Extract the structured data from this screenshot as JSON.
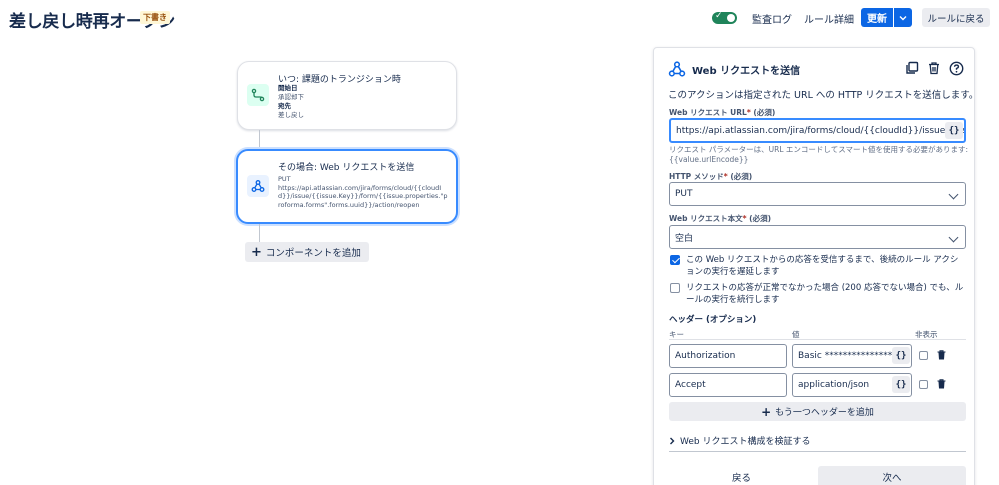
{
  "header": {
    "title": "差し戻し時再オープン",
    "draft_badge": "下書き",
    "audit_log": "監査ログ",
    "rule_details": "ルール詳細",
    "update": "更新",
    "back_to_rules": "ルールに戻る",
    "rule_enabled": true
  },
  "canvas": {
    "trigger": {
      "title": "いつ: 課題のトランジション時",
      "from_label": "開始日",
      "from_value": "承認却下",
      "to_label": "宛先",
      "to_value": "差し戻し"
    },
    "action": {
      "title": "その場合: Web リクエストを送信",
      "method": "PUT",
      "url": "https://api.atlassian.com/jira/forms/cloud/{{cloudId}}/issue/{{issue.Key}}/form/{{issue.properties.\"proforma.forms\".forms.uuid}}/action/reopen"
    },
    "add_component": "コンポーネントを追加"
  },
  "panel": {
    "title": "Web リクエストを送信",
    "description": "このアクションは指定された URL への HTTP リクエストを送信します。",
    "url_label": "Web リクエスト URL",
    "required": "(必須)",
    "url_value": "https://api.atlassian.com/jira/forms/cloud/{{cloudId}}/issue/{{issue.Key}}/f",
    "url_help": "リクエスト パラメーターは、URL エンコードしてスマート値を使用する必要があります: {{value.urlEncode}}",
    "method_label": "HTTP メソッド",
    "method_value": "PUT",
    "body_label": "Web リクエスト本文",
    "body_value": "空白",
    "wait_label": "この Web リクエストからの応答を受信するまで、後続のルール アクションの実行を遅延します",
    "wait_checked": true,
    "continue_label": "リクエストの応答が正常でなかった場合 (200 応答でない場合) でも、ルールの実行を続行します",
    "continue_checked": false,
    "headers_title": "ヘッダー (オプション)",
    "col_key": "キー",
    "col_value": "値",
    "col_hidden": "非表示",
    "headers": [
      {
        "key": "Authorization",
        "value": "Basic *******************"
      },
      {
        "key": "Accept",
        "value": "application/json"
      }
    ],
    "add_header": "もう一つヘッダーを追加",
    "verify": "Web リクエスト構成を検証する",
    "back": "戻る",
    "next": "次へ",
    "smart_value_glyph": "{}"
  },
  "colors": {
    "primary": "#0c66e4",
    "toggle_on": "#1f845a",
    "selected_border": "#388bff"
  }
}
